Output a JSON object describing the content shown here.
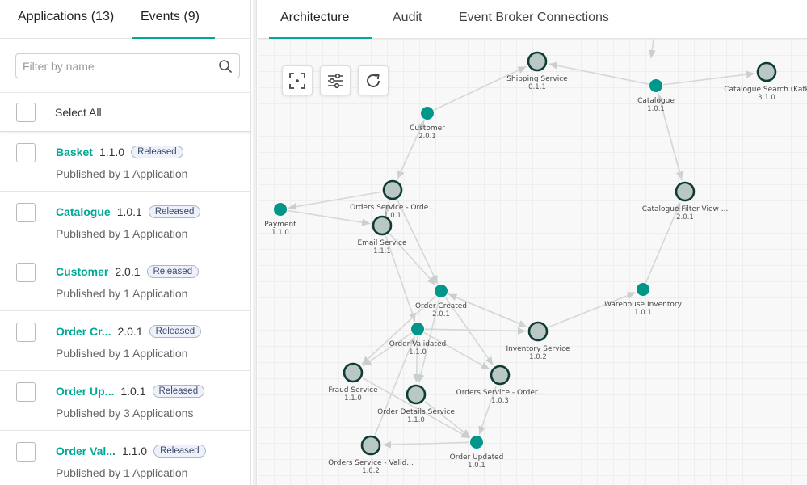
{
  "left_tabs": {
    "applications": "Applications (13)",
    "events": "Events (9)"
  },
  "filter": {
    "placeholder": "Filter by name"
  },
  "select_all": "Select All",
  "events": [
    {
      "name": "Basket",
      "version": "1.1.0",
      "status": "Released",
      "published": "Published by 1 Application"
    },
    {
      "name": "Catalogue",
      "version": "1.0.1",
      "status": "Released",
      "published": "Published by 1 Application"
    },
    {
      "name": "Customer",
      "version": "2.0.1",
      "status": "Released",
      "published": "Published by 1 Application"
    },
    {
      "name": "Order Cr...",
      "version": "2.0.1",
      "status": "Released",
      "published": "Published by 1 Application"
    },
    {
      "name": "Order Up...",
      "version": "1.0.1",
      "status": "Released",
      "published": "Published by 3 Applications"
    },
    {
      "name": "Order Val...",
      "version": "1.1.0",
      "status": "Released",
      "published": "Published by 1 Application"
    }
  ],
  "right_tabs": {
    "architecture": "Architecture",
    "audit": "Audit",
    "connections": "Event Broker Connections"
  },
  "colors": {
    "accent": "#00a995",
    "event_node": "#00968a",
    "app_node": "#b9c7c5",
    "edge": "#d4d8d8"
  },
  "graph": {
    "nodes": [
      {
        "id": "shipping",
        "kind": "app",
        "label": "Shipping Service",
        "version": "0.1.1"
      },
      {
        "id": "catalogue",
        "kind": "event",
        "label": "Catalogue",
        "version": "1.0.1"
      },
      {
        "id": "catsearch",
        "kind": "app",
        "label": "Catalogue Search (Kafk",
        "version": "3.1.0"
      },
      {
        "id": "customer",
        "kind": "event",
        "label": "Customer",
        "version": "2.0.1"
      },
      {
        "id": "ordersvc",
        "kind": "app",
        "label": "Orders Service - Orde...",
        "version": "1.0.1"
      },
      {
        "id": "catfilter",
        "kind": "app",
        "label": "Catalogue Filter View ...",
        "version": "2.0.1"
      },
      {
        "id": "payment",
        "kind": "event",
        "label": "Payment",
        "version": "1.1.0"
      },
      {
        "id": "email",
        "kind": "app",
        "label": "Email Service",
        "version": "1.1.1"
      },
      {
        "id": "ordercreated",
        "kind": "event",
        "label": "Order Created",
        "version": "2.0.1"
      },
      {
        "id": "warehouse",
        "kind": "event",
        "label": "Warehouse Inventory",
        "version": "1.0.1"
      },
      {
        "id": "ordervalidated",
        "kind": "event",
        "label": "Order Validated",
        "version": "1.1.0"
      },
      {
        "id": "inventory",
        "kind": "app",
        "label": "Inventory Service",
        "version": "1.0.2"
      },
      {
        "id": "fraud",
        "kind": "app",
        "label": "Fraud Service",
        "version": "1.1.0"
      },
      {
        "id": "orderdetails",
        "kind": "app",
        "label": "Order Details Service",
        "version": "1.1.0"
      },
      {
        "id": "ordersvc3",
        "kind": "app",
        "label": "Orders Service - Order...",
        "version": "1.0.3"
      },
      {
        "id": "ordersvcvalid",
        "kind": "app",
        "label": "Orders Service - Valid...",
        "version": "1.0.2"
      },
      {
        "id": "orderupdated",
        "kind": "event",
        "label": "Order Updated",
        "version": "1.0.1"
      }
    ],
    "edges": [
      [
        "catalogue",
        "shipping"
      ],
      [
        "catalogue",
        "catsearch"
      ],
      [
        "catalogue",
        "catfilter"
      ],
      [
        "catfilter",
        "catalogue"
      ],
      [
        "customer",
        "shipping"
      ],
      [
        "customer",
        "ordersvc"
      ],
      [
        "ordersvc",
        "customer"
      ],
      [
        "ordersvc",
        "payment"
      ],
      [
        "payment",
        "email"
      ],
      [
        "ordersvc",
        "email"
      ],
      [
        "ordersvc",
        "ordercreated"
      ],
      [
        "email",
        "ordercreated"
      ],
      [
        "email",
        "ordervalidated"
      ],
      [
        "ordercreated",
        "inventory"
      ],
      [
        "ordercreated",
        "fraud"
      ],
      [
        "ordercreated",
        "orderdetails"
      ],
      [
        "ordercreated",
        "ordersvc3"
      ],
      [
        "warehouse",
        "catfilter"
      ],
      [
        "inventory",
        "warehouse"
      ],
      [
        "ordervalidated",
        "inventory"
      ],
      [
        "ordervalidated",
        "fraud"
      ],
      [
        "ordervalidated",
        "orderdetails"
      ],
      [
        "ordervalidated",
        "ordersvc3"
      ],
      [
        "fraud",
        "orderupdated"
      ],
      [
        "orderdetails",
        "orderupdated"
      ],
      [
        "ordersvc3",
        "orderupdated"
      ],
      [
        "orderupdated",
        "ordersvcvalid"
      ],
      [
        "ordersvcvalid",
        "ordervalidated"
      ],
      [
        "inventory",
        "ordercreated"
      ]
    ]
  }
}
